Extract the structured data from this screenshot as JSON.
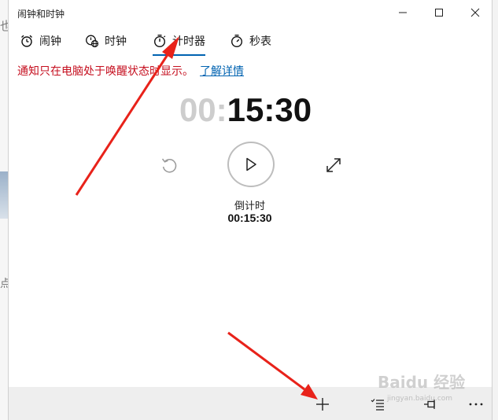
{
  "window": {
    "title": "闹钟和时钟"
  },
  "background": {
    "fragment_top": "也",
    "fragment_mid": "点"
  },
  "tabs": [
    {
      "label": "闹钟",
      "icon": "alarm-clock-icon"
    },
    {
      "label": "时钟",
      "icon": "world-clock-icon"
    },
    {
      "label": "计时器",
      "icon": "timer-icon",
      "selected": true
    },
    {
      "label": "秒表",
      "icon": "stopwatch-icon"
    }
  ],
  "notice": {
    "text": "通知只在电脑处于唤醒状态时显示。",
    "link": "了解详情"
  },
  "timer": {
    "display_hours": "00:",
    "display_rest": "15:30",
    "name": "倒计时",
    "value": "00:15:30"
  },
  "commandbar": {
    "add": "add-icon",
    "select": "multi-select-icon",
    "pin": "pin-icon",
    "more": "more-icon"
  },
  "watermark": {
    "text": "Baidu 经验",
    "url": "jingyan.baidu.com"
  },
  "colors": {
    "accent": "#0063b1",
    "notice": "#c50f1f",
    "annotation_arrow": "#e8221a"
  }
}
